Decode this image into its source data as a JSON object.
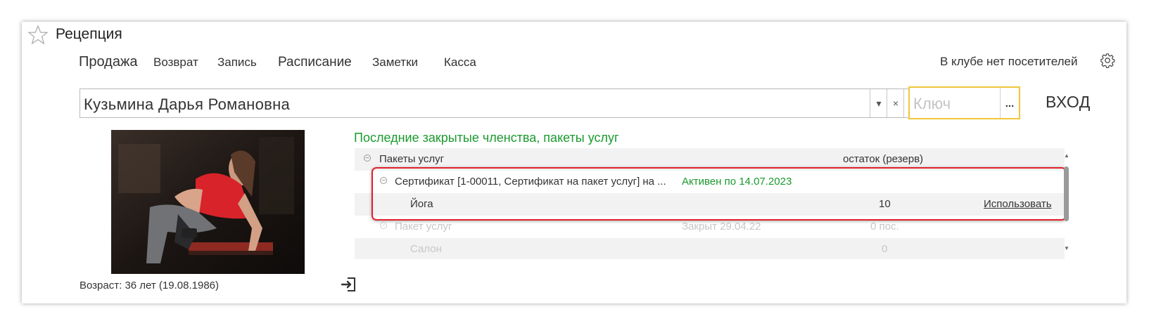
{
  "window": {
    "title": "Рецепция"
  },
  "nav": {
    "items": [
      {
        "label": "Продажа"
      },
      {
        "label": "Возврат"
      },
      {
        "label": "Запись"
      },
      {
        "label": "Расписание"
      },
      {
        "label": "Заметки"
      },
      {
        "label": "Касса"
      }
    ]
  },
  "status": {
    "text": "В клубе нет посетителей"
  },
  "client": {
    "value": "Кузьмина Дарья Романовна",
    "dropdown_symbol": "▾",
    "clear_symbol": "×",
    "open_symbol": "⧉"
  },
  "key": {
    "placeholder": "Ключ",
    "select_symbol": "..."
  },
  "enter_button": {
    "label": "ВХОД"
  },
  "profile": {
    "age_text": "Возраст: 36 лет (19.08.1986)"
  },
  "memberships": {
    "section_title": "Последние закрытые членства, пакеты услуг",
    "columns": {
      "name": "Пакеты услуг",
      "remainder": "остаток (резерв)"
    },
    "rows": [
      {
        "name": "Сертификат [1-00011, Сертификат на пакет услуг] на ...",
        "status": "Активен по 14.07.2023",
        "remainder": "",
        "action": ""
      },
      {
        "name": "Йога",
        "status": "",
        "remainder": "10",
        "action": "Использовать"
      },
      {
        "name": "Пакет услуг",
        "status": "Закрыт 29.04.22",
        "remainder": "0 пос.",
        "action": ""
      },
      {
        "name": "Салон",
        "status": "",
        "remainder": "0",
        "action": ""
      }
    ]
  },
  "colors": {
    "accent_green": "#1a9a2e",
    "key_border": "#f0c63a",
    "highlight_red": "#e0222b"
  }
}
